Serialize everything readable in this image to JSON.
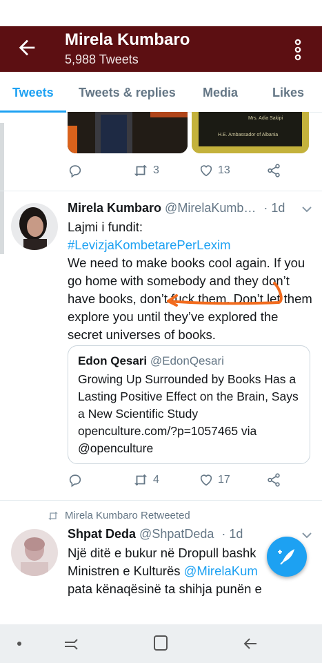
{
  "header": {
    "title": "Mirela Kumbaro",
    "subtitle": "5,988 Tweets"
  },
  "tabs": [
    {
      "label": "Tweets"
    },
    {
      "label": "Tweets & replies"
    },
    {
      "label": "Media"
    },
    {
      "label": "Likes"
    }
  ],
  "tweet0": {
    "image_caption_1": "Mrs. Adia Sakipi",
    "image_caption_2": "H.E. Ambassador of Albania",
    "retweets": "3",
    "likes": "13"
  },
  "tweet1": {
    "name": "Mirela Kumbaro",
    "handle": "@MirelaKumb…",
    "time": "· 1d",
    "line1": "Lajmi i fundit:",
    "hashtag": "#LevizjaKombetarePerLexim",
    "text": "We need to make books cool again. If you go home with somebody and they don’t have books, don’t fuck them. Don’t let them explore you until they’ve explored the secret universes of books.",
    "quote": {
      "name": "Edon Qesari",
      "handle": "@EdonQesari",
      "text": "Growing Up Surrounded by Books Has a Lasting Positive Effect on the Brain, Says a New Scientific Study openculture.com/?p=1057465 via @openculture"
    },
    "retweets": "4",
    "likes": "17"
  },
  "tweet2": {
    "retweeted_by": "Mirela Kumbaro Retweeted",
    "name": "Shpat Deda",
    "handle": "@ShpatDeda",
    "time": "· 1d",
    "line1": "Një ditë e bukur në Dropull bashk",
    "line2_pre": "Ministren e Kulturës ",
    "line2_mention": "@MirelaKum",
    "line3": "pata kënaqësinë ta shihja punën e"
  },
  "colors": {
    "header_bg": "#5c0f12",
    "accent": "#1da1f2",
    "annotation": "#f26b1d"
  }
}
